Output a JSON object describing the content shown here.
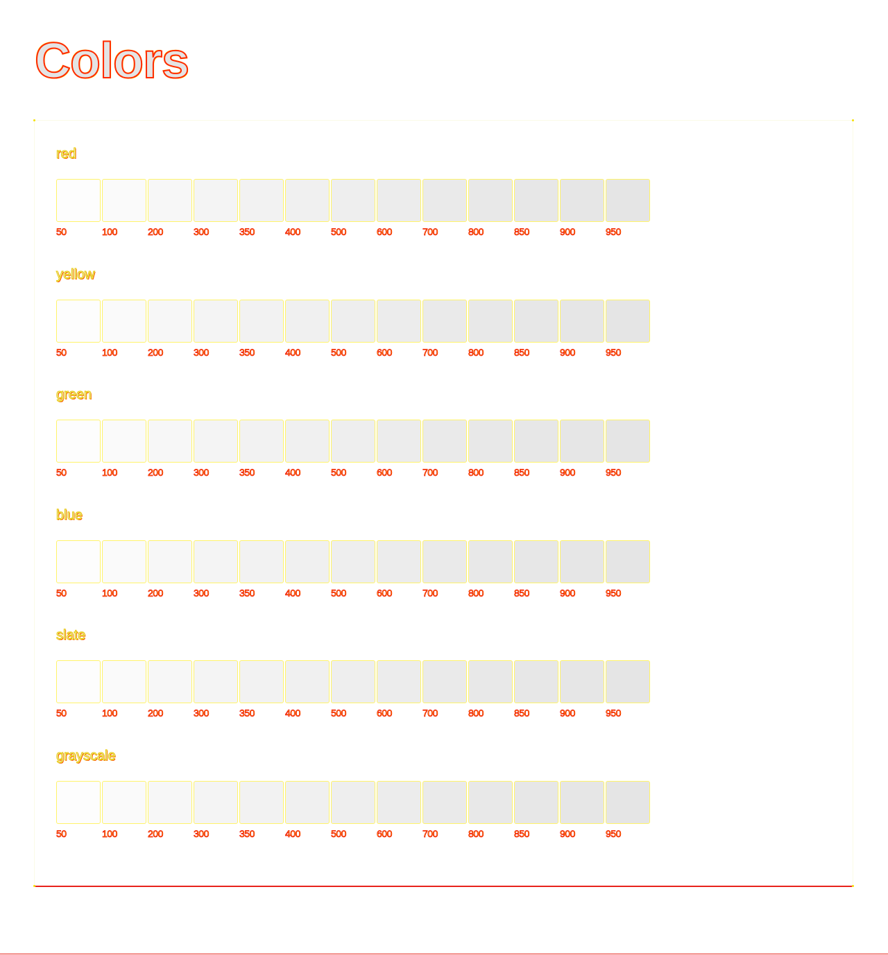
{
  "page": {
    "title": "Colors"
  },
  "palettes": [
    {
      "name": "red"
    },
    {
      "name": "yellow"
    },
    {
      "name": "green"
    },
    {
      "name": "blue"
    },
    {
      "name": "slate"
    },
    {
      "name": "grayscale"
    }
  ],
  "swatch_labels": [
    "50",
    "100",
    "200",
    "300",
    "350",
    "400",
    "500",
    "600",
    "700",
    "800",
    "850",
    "900",
    "950"
  ],
  "swatch_colors": [
    "#fdfdfd",
    "#fafafa",
    "#f7f7f7",
    "#f4f4f4",
    "#f2f2f2",
    "#f0f0f0",
    "#eeeeee",
    "#ececec",
    "#eaeaea",
    "#e8e8e8",
    "#e7e7e7",
    "#e6e6e6",
    "#e5e5e5"
  ],
  "accent_colors": {
    "outline_red": "#e8221c",
    "outline_yellow": "#ffe600"
  }
}
